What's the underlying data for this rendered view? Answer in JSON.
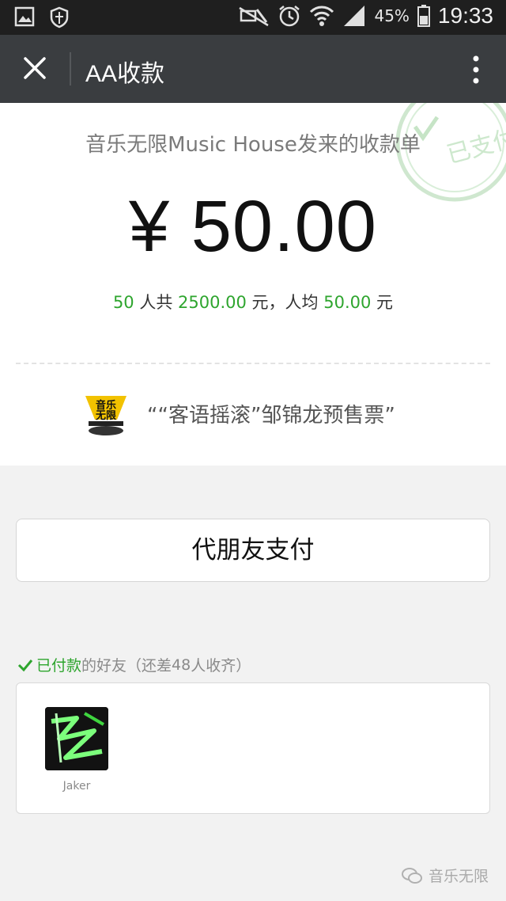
{
  "status_bar": {
    "battery": "45%",
    "time": "19:33"
  },
  "app_bar": {
    "title": "AA收款"
  },
  "request": {
    "sender": "音乐无限Music House发来的收款单",
    "amount": "¥ 50.00",
    "summary": {
      "people": "50",
      "t1": " 人共 ",
      "total": "2500.00",
      "t2": " 元，人均 ",
      "per": "50.00",
      "t3": " 元"
    },
    "stamp_text": "已支付",
    "product_logo_text": [
      "音乐",
      "无限"
    ],
    "product_name": "““客语摇滚”邹锦龙预售票”"
  },
  "pay_button": "代朋友支付",
  "paid_section": {
    "label_paid": "已付款",
    "label_rest": " 的好友（还差",
    "remaining": "48",
    "label_end": "人收齐）"
  },
  "friends": [
    {
      "name": "Jaker"
    }
  ],
  "watermark": "音乐无限",
  "colors": {
    "accent_green": "#2ea52e",
    "appbar": "#3a3d40"
  }
}
